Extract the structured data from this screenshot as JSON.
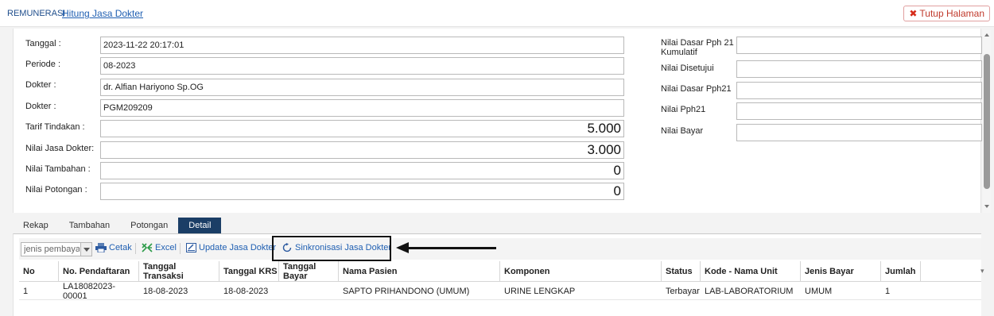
{
  "header": {
    "section": "REMUNERASI",
    "page": "Hitung Jasa Dokter",
    "close_label": "Tutup Halaman"
  },
  "form_left": {
    "tanggal_label": "Tanggal :",
    "tanggal_value": "2023-11-22 20:17:01",
    "periode_label": "Periode :",
    "periode_value": "08-2023",
    "dokter_label": "Dokter :",
    "dokter_value": "dr. Alfian Hariyono Sp.OG",
    "dokter_kode_label": "Dokter :",
    "dokter_kode_value": "PGM209209",
    "tarif_label": "Tarif Tindakan :",
    "tarif_value": "5.000",
    "jasa_label": "Nilai Jasa Dokter:",
    "jasa_value": "3.000",
    "tambahan_label": "Nilai Tambahan :",
    "tambahan_value": "0",
    "potongan_label": "Nilai Potongan :",
    "potongan_value": "0"
  },
  "form_right": {
    "dasar_kumulatif_label": "Nilai Dasar Pph 21 Kumulatif",
    "dasar_kumulatif_value": "",
    "disetujui_label": "Nilai Disetujui",
    "disetujui_value": "",
    "dasar_pph21_label": "Nilai Dasar Pph21",
    "dasar_pph21_value": "",
    "pph21_label": "Nilai Pph21",
    "pph21_value": "",
    "bayar_label": "Nilai Bayar",
    "bayar_value": ""
  },
  "tabs": [
    "Rekap",
    "Tambahan",
    "Potongan",
    "Detail"
  ],
  "active_tab": "Detail",
  "toolbar": {
    "select_placeholder": "jenis pembayaran",
    "cetak": "Cetak",
    "excel": "Excel",
    "update": "Update Jasa Dokter",
    "sinkronisasi": "Sinkronisasi Jasa Dokter"
  },
  "table": {
    "headers": [
      "No",
      "No. Pendaftaran",
      "Tanggal Transaksi",
      "Tanggal KRS",
      "Tanggal Bayar",
      "Nama Pasien",
      "Komponen",
      "Status",
      "Kode - Nama Unit",
      "Jenis Bayar",
      "Jumlah"
    ],
    "rows": [
      [
        "1",
        "LA18082023-00001",
        "18-08-2023",
        "18-08-2023",
        "",
        "SAPTO PRIHANDONO (UMUM)",
        "URINE LENGKAP",
        "Terbayar",
        "LAB-LABORATORIUM",
        "UMUM",
        "1"
      ]
    ]
  },
  "colors": {
    "accent": "#1b3e66",
    "link": "#1f5fb2",
    "danger": "#c0392b"
  }
}
